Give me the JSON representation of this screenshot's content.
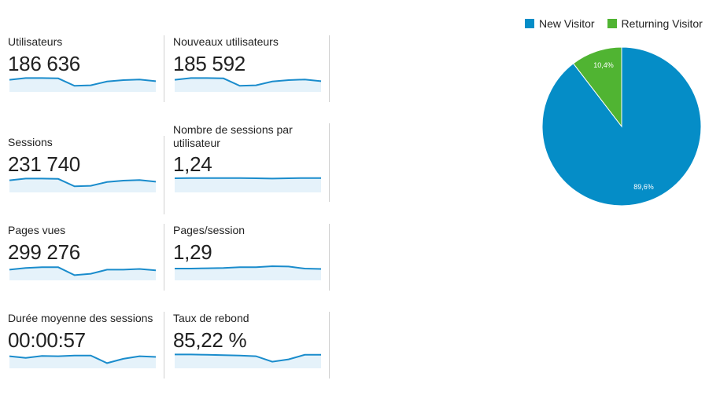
{
  "metrics": [
    {
      "label": "Utilisateurs",
      "value": "186 636",
      "spark": [
        0.7,
        0.8,
        0.8,
        0.78,
        0.35,
        0.38,
        0.6,
        0.68,
        0.72,
        0.62
      ]
    },
    {
      "label": "Nouveaux utilisateurs",
      "value": "185 592",
      "spark": [
        0.7,
        0.8,
        0.8,
        0.78,
        0.35,
        0.38,
        0.6,
        0.68,
        0.72,
        0.62
      ]
    },
    {
      "label": "Sessions",
      "value": "231 740",
      "spark": [
        0.7,
        0.8,
        0.8,
        0.78,
        0.35,
        0.38,
        0.6,
        0.68,
        0.72,
        0.62
      ]
    },
    {
      "label": "Nombre de sessions par utilisateur",
      "value": "1,24",
      "spark": [
        0.82,
        0.83,
        0.83,
        0.83,
        0.83,
        0.82,
        0.8,
        0.82,
        0.83,
        0.83
      ]
    },
    {
      "label": "Pages vues",
      "value": "299 276",
      "spark": [
        0.62,
        0.72,
        0.76,
        0.76,
        0.3,
        0.38,
        0.62,
        0.62,
        0.66,
        0.58
      ]
    },
    {
      "label": "Pages/session",
      "value": "1,29",
      "spark": [
        0.68,
        0.68,
        0.7,
        0.72,
        0.76,
        0.76,
        0.82,
        0.8,
        0.68,
        0.66
      ]
    },
    {
      "label": "Durée moyenne des sessions",
      "value": "00:00:57",
      "spark": [
        0.7,
        0.6,
        0.72,
        0.7,
        0.74,
        0.74,
        0.3,
        0.55,
        0.7,
        0.66
      ]
    },
    {
      "label": "Taux de rebond",
      "value": "85,22 %",
      "spark": [
        0.8,
        0.8,
        0.78,
        0.76,
        0.74,
        0.7,
        0.38,
        0.52,
        0.78,
        0.78
      ]
    }
  ],
  "colors": {
    "spark_line": "#1a8ccc",
    "spark_fill": "#e5f2fa",
    "new_visitor": "#058dc7",
    "returning_visitor": "#50b432"
  },
  "chart_data": {
    "type": "pie",
    "title": "",
    "legend_position": "top-right",
    "slices": [
      {
        "name": "New Visitor",
        "value": 89.6,
        "label": "89,6%",
        "color": "#058dc7"
      },
      {
        "name": "Returning Visitor",
        "value": 10.4,
        "label": "10,4%",
        "color": "#50b432"
      }
    ]
  }
}
